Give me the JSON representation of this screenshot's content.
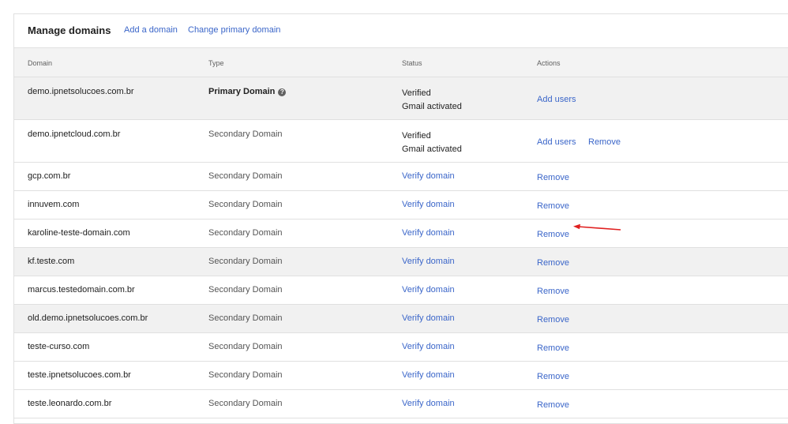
{
  "header": {
    "title": "Manage domains",
    "add_domain": "Add a domain",
    "change_primary": "Change primary domain"
  },
  "columns": {
    "domain": "Domain",
    "type": "Type",
    "status": "Status",
    "actions": "Actions"
  },
  "rows": [
    {
      "domain": "demo.ipnetsolucoes.com.br",
      "type": "Primary Domain",
      "status_line1": "Verified",
      "status_line2": "Gmail activated",
      "action1": "Add users",
      "action2": ""
    },
    {
      "domain": "demo.ipnetcloud.com.br",
      "type": "Secondary Domain",
      "status_line1": "Verified",
      "status_line2": "Gmail activated",
      "action1": "Add users",
      "action2": "Remove"
    },
    {
      "domain": "gcp.com.br",
      "type": "Secondary Domain",
      "status": "Verify domain",
      "action": "Remove"
    },
    {
      "domain": "innuvem.com",
      "type": "Secondary Domain",
      "status": "Verify domain",
      "action": "Remove"
    },
    {
      "domain": "karoline-teste-domain.com",
      "type": "Secondary Domain",
      "status": "Verify domain",
      "action": "Remove"
    },
    {
      "domain": "kf.teste.com",
      "type": "Secondary Domain",
      "status": "Verify domain",
      "action": "Remove"
    },
    {
      "domain": "marcus.testedomain.com.br",
      "type": "Secondary Domain",
      "status": "Verify domain",
      "action": "Remove"
    },
    {
      "domain": "old.demo.ipnetsolucoes.com.br",
      "type": "Secondary Domain",
      "status": "Verify domain",
      "action": "Remove"
    },
    {
      "domain": "teste-curso.com",
      "type": "Secondary Domain",
      "status": "Verify domain",
      "action": "Remove"
    },
    {
      "domain": "teste.ipnetsolucoes.com.br",
      "type": "Secondary Domain",
      "status": "Verify domain",
      "action": "Remove"
    },
    {
      "domain": "teste.leonardo.com.br",
      "type": "Secondary Domain",
      "status": "Verify domain",
      "action": "Remove"
    }
  ],
  "icons": {
    "help": "question-circle-icon",
    "annotation": "red-arrow-icon"
  },
  "colors": {
    "link": "#3b66c9",
    "annotation": "#e02020",
    "row_highlight": "#f1f1f1",
    "header_bg": "#f3f3f3"
  }
}
